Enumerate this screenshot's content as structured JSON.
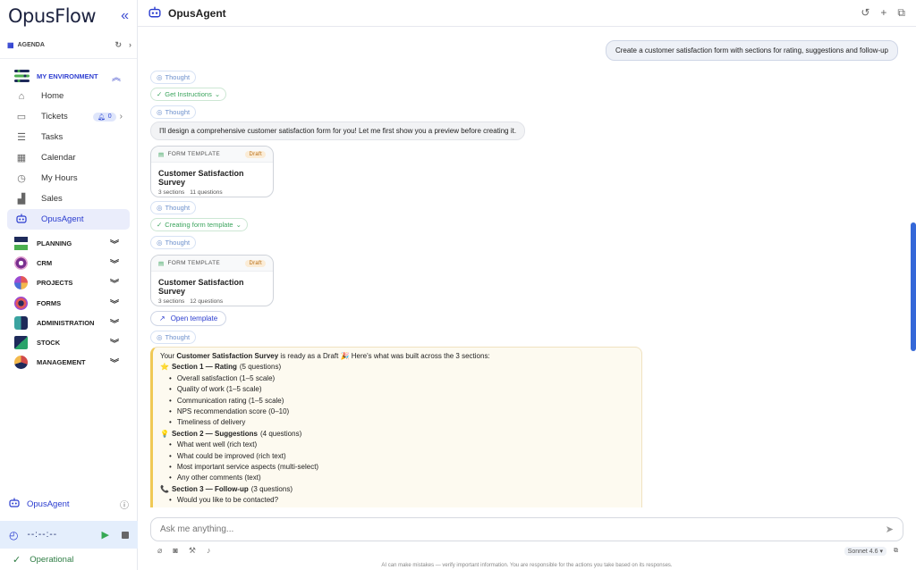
{
  "app": {
    "logo": "OpusFlow"
  },
  "sidebar": {
    "agenda_label": "AGENDA",
    "environment_label": "MY ENVIRONMENT",
    "items": [
      {
        "label": "Home",
        "icon": "home-icon"
      },
      {
        "label": "Tickets",
        "icon": "ticket-icon",
        "badge": "0"
      },
      {
        "label": "Tasks",
        "icon": "tasks-icon"
      },
      {
        "label": "Calendar",
        "icon": "calendar-icon"
      },
      {
        "label": "My Hours",
        "icon": "hours-icon"
      },
      {
        "label": "Sales",
        "icon": "sales-icon"
      },
      {
        "label": "OpusAgent",
        "icon": "robot-icon",
        "active": true
      }
    ],
    "modules": [
      {
        "label": "PLANNING",
        "color": "#2b5d9c"
      },
      {
        "label": "CRM",
        "color": "#7a2f8f"
      },
      {
        "label": "PROJECTS",
        "color": "#e45757"
      },
      {
        "label": "FORMS",
        "color": "#9c4bd1"
      },
      {
        "label": "ADMINISTRATION",
        "color": "#3aa3a0"
      },
      {
        "label": "STOCK",
        "color": "#2aa36a"
      },
      {
        "label": "MANAGEMENT",
        "color": "#d24a4a"
      }
    ],
    "bottom_agent": "OpusAgent",
    "timer": "--:--:--",
    "status": "Operational"
  },
  "header": {
    "title": "OpusAgent"
  },
  "chat": {
    "user_message": "Create a customer satisfaction form with sections for rating, suggestions and follow-up",
    "thought": "Thought",
    "get_instructions": "Get Instructions",
    "bot_intro": "I'll design a comprehensive customer satisfaction form for you! Let me first show you a preview before creating it.",
    "card1": {
      "type": "FORM TEMPLATE",
      "status": "Draft",
      "name": "Customer Satisfaction Survey",
      "sections": "3 sections",
      "questions": "11 questions"
    },
    "creating": "Creating form template",
    "card2": {
      "type": "FORM TEMPLATE",
      "status": "Draft",
      "name": "Customer Satisfaction Survey",
      "sections": "3 sections",
      "questions": "12 questions"
    },
    "open_template": "Open template",
    "answer": {
      "intro_a": "Your ",
      "intro_b": "Customer Satisfaction Survey",
      "intro_c": " is ready as a Draft 🎉 Here's what was built across the 3 sections:",
      "s1_emoji": "⭐",
      "s1_title": "Section 1 — Rating",
      "s1_count": "(5 questions)",
      "s1_items": [
        "Overall satisfaction (1–5 scale)",
        "Quality of work (1–5 scale)",
        "Communication rating (1–5 scale)",
        "NPS recommendation score (0–10)",
        "Timeliness of delivery"
      ],
      "s2_emoji": "💡",
      "s2_title": "Section 2 — Suggestions",
      "s2_count": "(4 questions)",
      "s2_items": [
        "What went well (rich text)",
        "What could be improved (rich text)",
        "Most important service aspects (multi-select)",
        "Any other comments (text)"
      ],
      "s3_emoji": "📞",
      "s3_title": "Section 3 — Follow-up",
      "s3_count": "(3 questions)",
      "s3_items": [
        "Would you like to be contacted?"
      ]
    }
  },
  "composer": {
    "placeholder": "Ask me anything...",
    "model": "Sonnet 4.6",
    "disclaimer": "AI can make mistakes — verify important information. You are responsible for the actions you take based on its responses."
  }
}
